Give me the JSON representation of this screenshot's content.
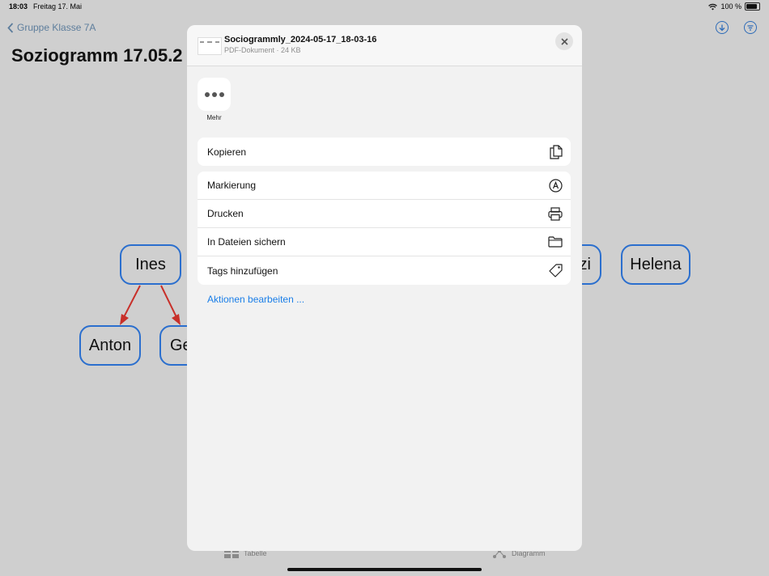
{
  "status_bar": {
    "time": "18:03",
    "date": "Freitag 17. Mai",
    "battery": "100 %"
  },
  "background": {
    "back_label": "Gruppe Klasse 7A",
    "title": "Soziogramm 17.05.2",
    "nodes": {
      "ines": "Ines",
      "anton": "Anton",
      "ge": "Ge",
      "zi": "zi",
      "helena": "Helena"
    },
    "tabs": {
      "table": "Tabelle",
      "diagram": "Diagramm"
    }
  },
  "share_sheet": {
    "file_name": "Sociogrammly_2024-05-17_18-03-16",
    "file_meta": "PDF-Dokument · 24 KB",
    "more_label": "Mehr",
    "actions_group1": [
      {
        "label": "Kopieren",
        "icon": "copy-icon"
      }
    ],
    "actions_group2": [
      {
        "label": "Markierung",
        "icon": "markup-icon"
      },
      {
        "label": "Drucken",
        "icon": "printer-icon"
      },
      {
        "label": "In Dateien sichern",
        "icon": "folder-icon"
      },
      {
        "label": "Tags hinzufügen",
        "icon": "tag-icon"
      }
    ],
    "edit_actions": "Aktionen bearbeiten ..."
  },
  "colors": {
    "accent": "#1a7ee8",
    "node_border": "#2b6fce",
    "arrow": "#c8302a"
  }
}
